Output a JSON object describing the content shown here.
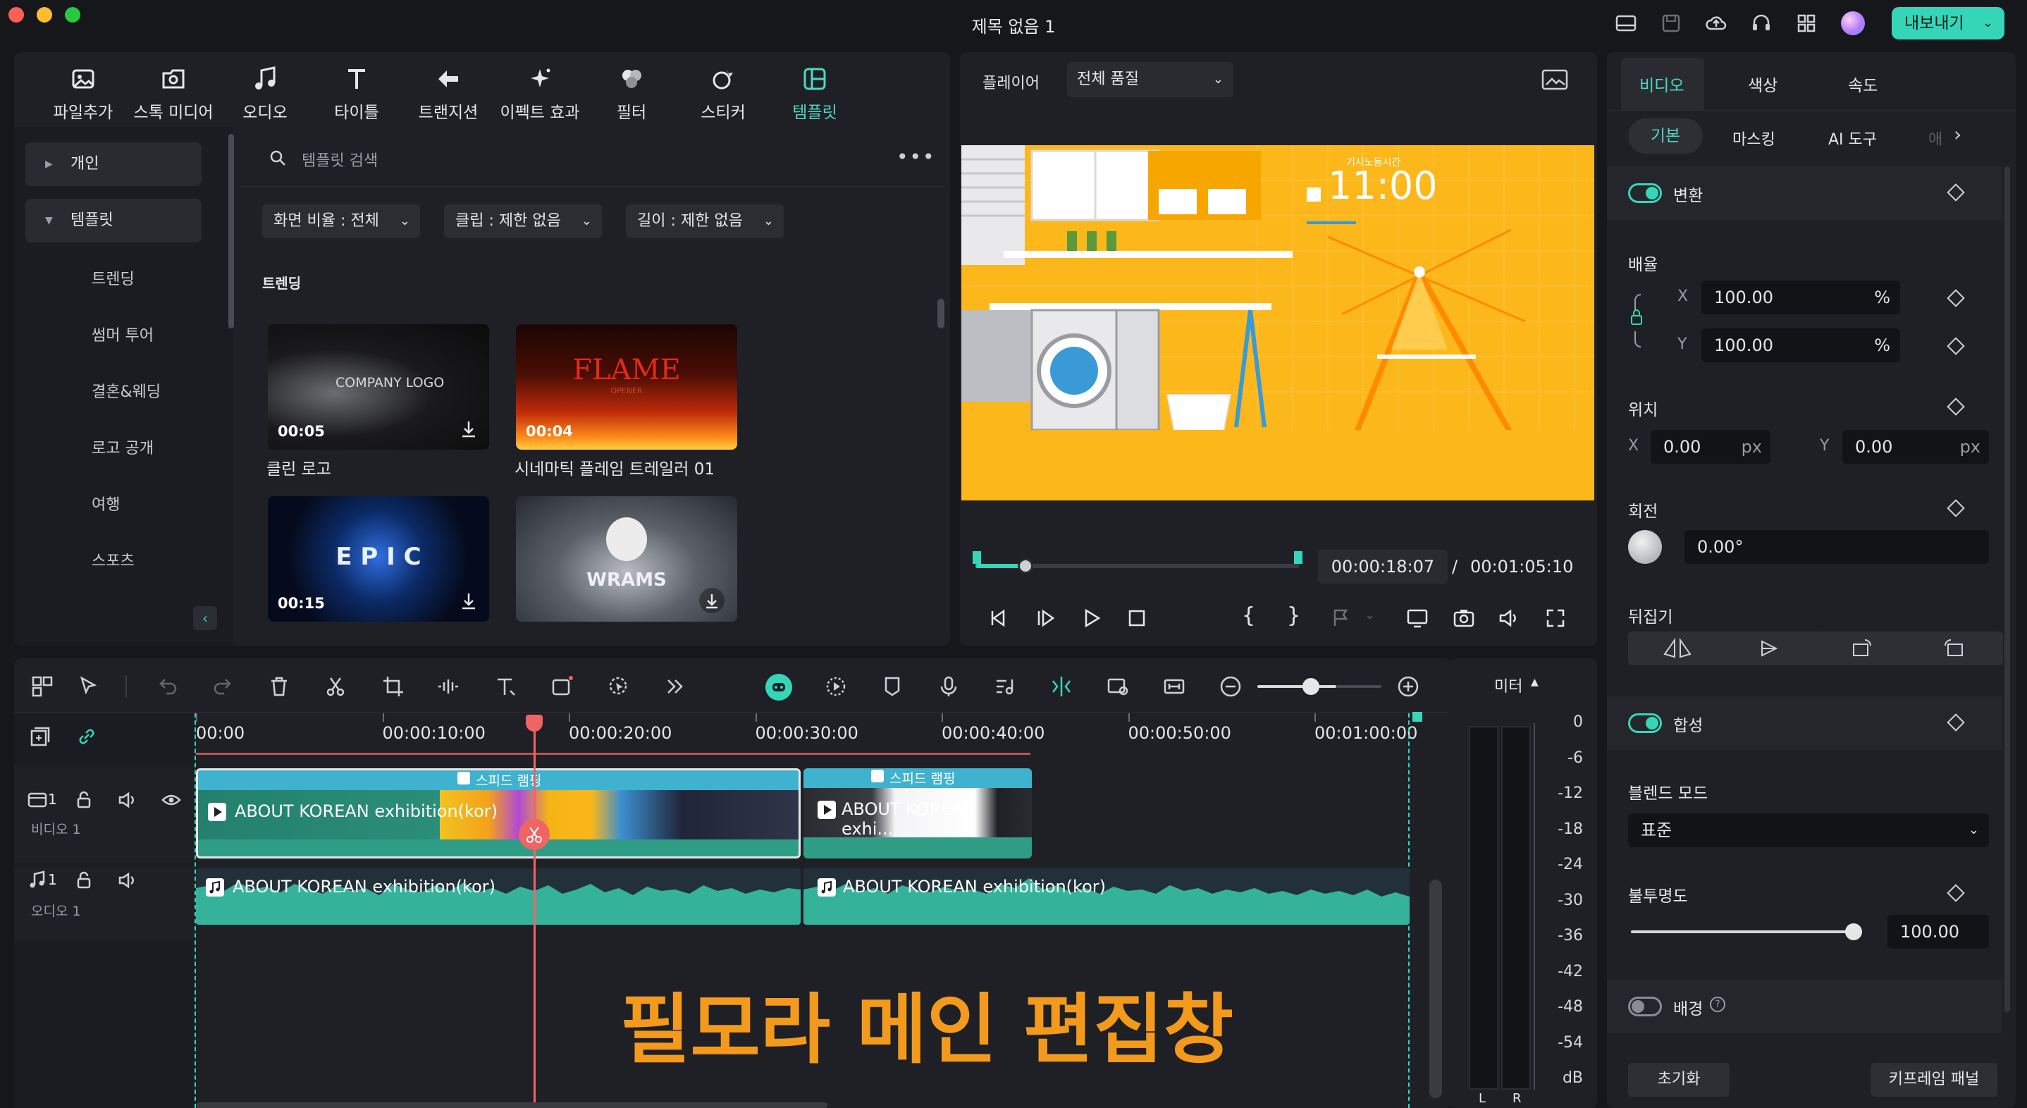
{
  "window": {
    "title": "제목 없음 1",
    "export_label": "내보내기"
  },
  "media_toolbar": [
    {
      "label": "파일추가",
      "icon": "import-icon"
    },
    {
      "label": "스톡 미디어",
      "icon": "stock-media-icon"
    },
    {
      "label": "오디오",
      "icon": "music-note-icon"
    },
    {
      "label": "타이틀",
      "icon": "title-t-icon"
    },
    {
      "label": "트랜지션",
      "icon": "transition-icon"
    },
    {
      "label": "이펙트 효과",
      "icon": "effects-sparkle-icon"
    },
    {
      "label": "필터",
      "icon": "filter-icon"
    },
    {
      "label": "스티커",
      "icon": "sticker-icon"
    },
    {
      "label": "템플릿",
      "icon": "template-icon"
    }
  ],
  "sidebar": {
    "personal": "개인",
    "template": "템플릿",
    "items": [
      "트렌딩",
      "썸머 투어",
      "결혼&웨딩",
      "로고 공개",
      "여행",
      "스포츠"
    ]
  },
  "library": {
    "search_placeholder": "템플릿 검색",
    "filters": [
      "화면 비율 : 전체",
      "클립 : 제한 없음",
      "길이 : 제한 없음"
    ],
    "section": "트렌딩",
    "templates": [
      {
        "title": "클린 로고",
        "duration": "00:05",
        "art": "COMPANY LOGO"
      },
      {
        "title": "시네마틱 플레임 트레일러 01",
        "duration": "00:04",
        "art": "FLAME",
        "art_sub": "OPENER"
      },
      {
        "title": "",
        "duration": "00:15",
        "art": "E P I C"
      },
      {
        "title": "",
        "duration": "",
        "art": "WRAMS"
      }
    ]
  },
  "player": {
    "label": "플레이어",
    "quality": "전체 품질",
    "current_time": "00:00:18:07",
    "separator": "/",
    "total_time": "00:01:05:10",
    "progress": 0.155,
    "preview_text": {
      "time": "11:00",
      "caption": "기사노동시간"
    }
  },
  "inspector": {
    "tabs": [
      "비디오",
      "색상",
      "속도"
    ],
    "subtabs": [
      "기본",
      "마스킹",
      "AI 도구",
      "애"
    ],
    "transform": "변환",
    "scale": {
      "label": "배율",
      "x_label": "X",
      "x": "100.00",
      "y_label": "Y",
      "y": "100.00",
      "unit": "%"
    },
    "position": {
      "label": "위치",
      "x_label": "X",
      "x": "0.00",
      "y_label": "Y",
      "y": "0.00",
      "unit": "px"
    },
    "rotation": {
      "label": "회전",
      "value": "0.00°"
    },
    "flip": {
      "label": "뒤집기"
    },
    "composite": "합성",
    "blend": {
      "label": "블렌드 모드",
      "value": "표준"
    },
    "opacity": {
      "label": "불투명도",
      "value": "100.00",
      "level": 1.0
    },
    "background": "배경",
    "reset": "초기화",
    "keyframe_panel": "키프레임 패널"
  },
  "timeline": {
    "ruler": [
      "00:00",
      "00:00:10:00",
      "00:00:20:00",
      "00:00:30:00",
      "00:00:40:00",
      "00:00:50:00",
      "00:01:00:00"
    ],
    "video_track": {
      "name": "비디오 1",
      "number": "1"
    },
    "audio_track": {
      "name": "오디오 1",
      "number": "1"
    },
    "clips": [
      {
        "title": "ABOUT KOREAN exhibition(kor)",
        "badge": "스피드 램핑"
      },
      {
        "title": "ABOUT KOREAN exhi...",
        "badge": "스피드 램핑"
      }
    ],
    "audio_clips": [
      "ABOUT KOREAN exhibition(kor)",
      "ABOUT KOREAN exhibition(kor)"
    ],
    "overlay_caption": "필모라 메인 편집창"
  },
  "meter": {
    "label": "미터",
    "scale": [
      "0",
      "-6",
      "-12",
      "-18",
      "-24",
      "-30",
      "-36",
      "-42",
      "-48",
      "-54",
      "dB"
    ],
    "channels": [
      "L",
      "R"
    ]
  },
  "colors": {
    "accent": "#35d6b8",
    "playhead": "#f06464",
    "caption": "#f39a1c"
  }
}
